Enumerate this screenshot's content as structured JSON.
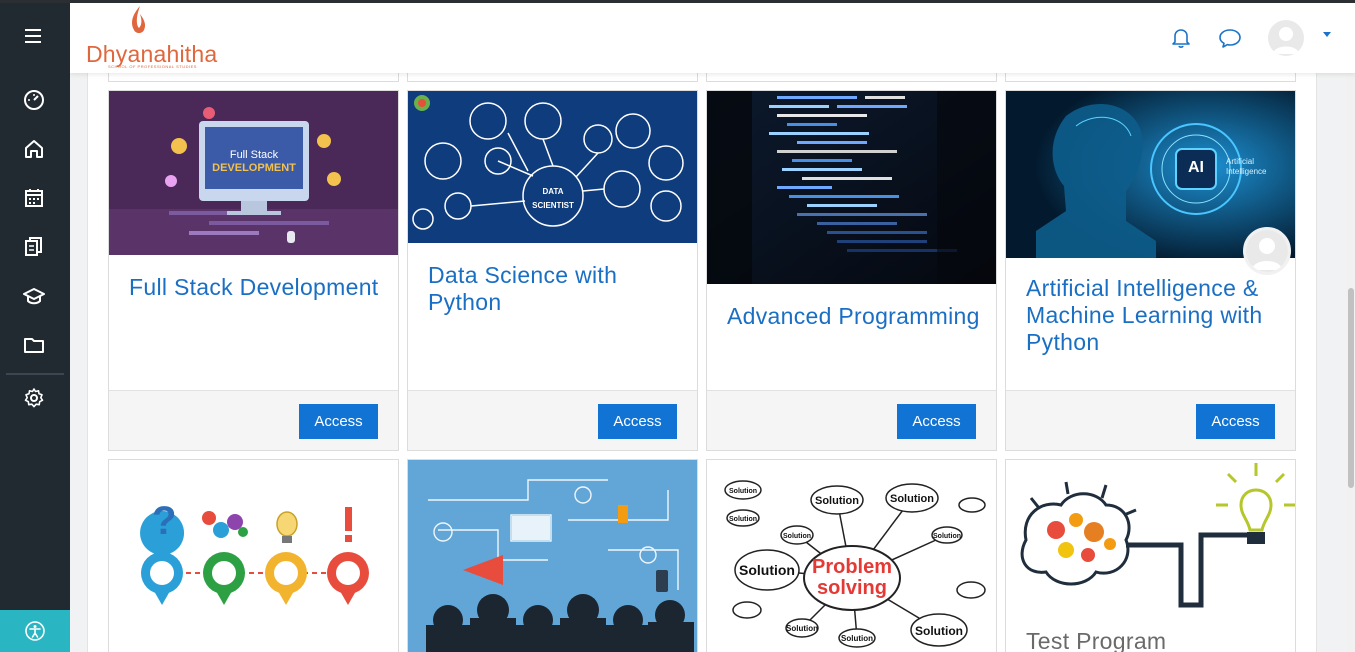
{
  "app": {
    "logo_text": "Dhyanahitha",
    "logo_subtitle": "SCHOOL OF PROFESSIONAL STUDIES",
    "brand_color": "#e0673d",
    "accent_color": "#1173d4"
  },
  "sidebar": {
    "items": [
      {
        "icon": "menu-icon"
      },
      {
        "icon": "dashboard-icon"
      },
      {
        "icon": "home-icon"
      },
      {
        "icon": "calendar-icon"
      },
      {
        "icon": "files-icon"
      },
      {
        "icon": "graduation-cap-icon"
      },
      {
        "icon": "folder-icon"
      },
      {
        "icon": "gear-icon"
      }
    ],
    "accessibility_icon": "accessibility-icon"
  },
  "header": {
    "icons": [
      "bell-icon",
      "chat-icon",
      "user-avatar",
      "chevron-down-icon"
    ]
  },
  "courses": [
    {
      "title": "Full Stack Development",
      "button": "Access",
      "image": "full-stack-banner"
    },
    {
      "title": "Data Science with Python",
      "button": "Access",
      "image": "data-scientist-banner"
    },
    {
      "title": "Advanced Programming",
      "button": "Access",
      "image": "code-screen-banner"
    },
    {
      "title": "Artificial Intelligence & Machine Learning with Python",
      "button": "Access",
      "image": "ai-banner"
    },
    {
      "title": "",
      "image": "question-gears-banner"
    },
    {
      "title": "",
      "image": "people-ideas-banner"
    },
    {
      "title": "",
      "image": "problem-solving-banner"
    },
    {
      "title": "Test Program",
      "image": "brain-bulb-banner"
    }
  ],
  "image_text": {
    "fullstack_small": "Full Stack",
    "fullstack_big": "DEVELOPMENT",
    "data_scientist": "DATA",
    "data_scientist2": "SCIENTIST",
    "ai_badge": "AI",
    "ai_caption1": "Artificial",
    "ai_caption2": "Intelligence",
    "problem1": "Problem",
    "problem2": "solving",
    "solution": "Solution"
  }
}
